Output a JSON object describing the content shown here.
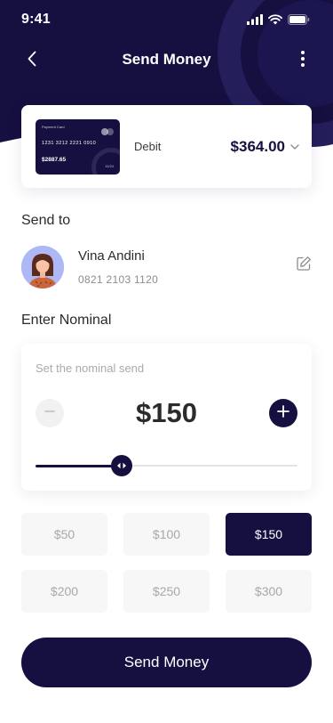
{
  "status_bar": {
    "time": "9:41"
  },
  "nav": {
    "title": "Send Money"
  },
  "card": {
    "label": "Payment Card",
    "number": "1231  3212  2221  0910",
    "balance": "$2887.65",
    "expiry": "11/24",
    "type": "Debit",
    "amount": "$364.00"
  },
  "send_to": {
    "title": "Send to",
    "recipient_name": "Vina Andini",
    "recipient_phone": "0821 2103 1120"
  },
  "nominal": {
    "title": "Enter Nominal",
    "hint": "Set the nominal send",
    "value": "$150",
    "slider_level": 0.33
  },
  "amount_options": [
    {
      "label": "$50",
      "selected": false
    },
    {
      "label": "$100",
      "selected": false
    },
    {
      "label": "$150",
      "selected": true
    },
    {
      "label": "$200",
      "selected": false
    },
    {
      "label": "$250",
      "selected": false
    },
    {
      "label": "$300",
      "selected": false
    }
  ],
  "actions": {
    "send_label": "Send Money"
  },
  "colors": {
    "primary": "#151040",
    "background": "#ffffff",
    "muted_text": "#a8a8a8",
    "chip_bg": "#f7f7f7"
  }
}
